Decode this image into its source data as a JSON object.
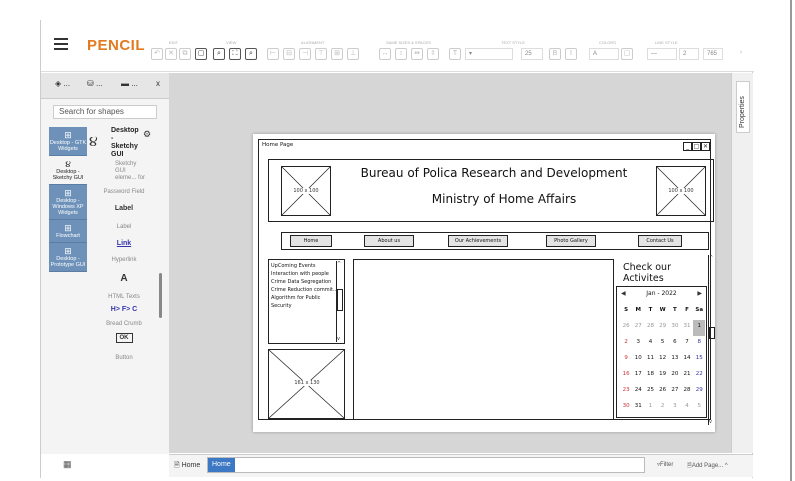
{
  "app": {
    "logo": "PENCIL"
  },
  "toolbar": {
    "groups": [
      "EDIT",
      "VIEW",
      "ALIGNMENT",
      "SAME SIZES & SPACES",
      "TEXT STYLE",
      "COLORS",
      "LINE STYLE"
    ],
    "font_size": "25",
    "line_width": "2",
    "zoom_value": "765",
    "color_label": "A"
  },
  "left_tabs": [
    "...",
    "...",
    "..."
  ],
  "left_tab_close": "x",
  "search": {
    "placeholder": "Search for shapes"
  },
  "collections": [
    {
      "label": "Desktop - GTK Widgets",
      "icon": "⊞"
    },
    {
      "label": "Desktop - Sketchy GUI",
      "icon": "૪"
    },
    {
      "label": "Desktop - Windows XP Widgets",
      "icon": "⊞"
    },
    {
      "label": "Flowchart",
      "icon": "⊞"
    },
    {
      "label": "Desktop - Prototype GUI",
      "icon": "⊞"
    }
  ],
  "collection_info": {
    "title": "Desktop - Sketchy GUI",
    "desc": "Sketchy GUI eleme... for"
  },
  "shapes": [
    {
      "visual": "",
      "label": "Password Field"
    },
    {
      "visual": "Label",
      "label": "Label"
    },
    {
      "visual": "Link",
      "label": "Hyperlink"
    },
    {
      "visual": "A",
      "label": "HTML Texts"
    },
    {
      "visual": "H> F> C",
      "label": "Bread Crumb"
    },
    {
      "visual": "OK",
      "label": "Button"
    }
  ],
  "right_panel": {
    "tab_label": "Properties"
  },
  "status": {
    "home": "Home",
    "active_page": "Home",
    "filter": "Filter",
    "add_page": "Add Page..."
  },
  "mockup": {
    "window_title": "Home Page",
    "header_title": "Bureau of Polica Research and Development",
    "header_subtitle": "Ministry of Home Affairs",
    "logo_left": "100 x 100",
    "logo_right": "100 x 100",
    "nav": [
      "Home",
      "About us",
      "Our Achievements",
      "Photo Gallery",
      "Contact Us"
    ],
    "events": [
      "UpComing Events",
      "Interaction with people",
      "Crime Data Segregation",
      "Crime Reduction commit...",
      "Algorithm for Public",
      "Security"
    ],
    "image_label": "161 x 130",
    "activities_title": "Check our Activites",
    "calendar": {
      "month": "Jan - 2022",
      "days": [
        "S",
        "M",
        "T",
        "W",
        "T",
        "F",
        "Sa"
      ],
      "weeks": [
        [
          "26",
          "27",
          "28",
          "29",
          "30",
          "31",
          "1"
        ],
        [
          "2",
          "3",
          "4",
          "5",
          "6",
          "7",
          "8"
        ],
        [
          "9",
          "10",
          "11",
          "12",
          "13",
          "14",
          "15"
        ],
        [
          "16",
          "17",
          "18",
          "19",
          "20",
          "21",
          "22"
        ],
        [
          "23",
          "24",
          "25",
          "26",
          "27",
          "28",
          "29"
        ],
        [
          "30",
          "31",
          "1",
          "2",
          "3",
          "4",
          "5"
        ]
      ]
    }
  }
}
